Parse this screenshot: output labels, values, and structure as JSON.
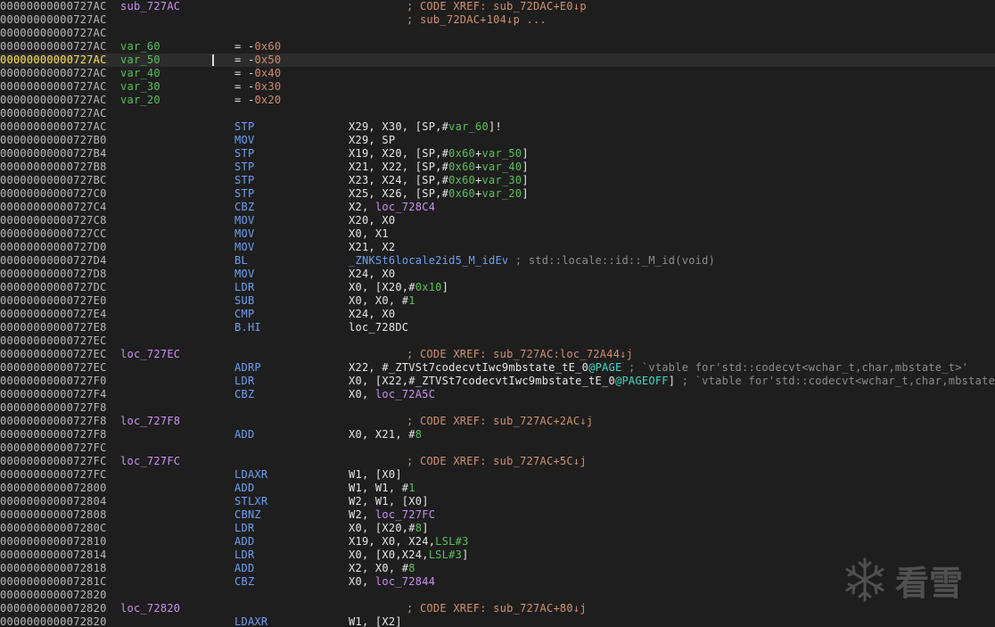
{
  "colors": {
    "background": "#1e1e1e",
    "current_line": "#2c2c2c",
    "address": "#b8b8b8",
    "current_address": "#ffe24a",
    "mnemonic": "#6d9ff5",
    "operand": "#e6e6e6",
    "label": "#c98ff0",
    "variable": "#58c058",
    "comment": "#8c8c8c",
    "xref": "#d0906e",
    "page_ref": "#3fd9c4"
  },
  "watermark": {
    "icon": "snowflake-icon",
    "text": "看雪"
  },
  "lines": [
    {
      "addr": "00000000000727AC",
      "label": "sub_727AC",
      "comment": "; CODE XREF: sub_72DAC+E0↓p"
    },
    {
      "addr": "00000000000727AC",
      "comment": "; sub_72DAC+104↓p ..."
    },
    {
      "addr": "00000000000727AC"
    },
    {
      "addr": "00000000000727AC",
      "var": "var_60",
      "eq": "= -0x60"
    },
    {
      "addr": "00000000000727AC",
      "var": "var_50",
      "eq": "= -0x50",
      "current": true
    },
    {
      "addr": "00000000000727AC",
      "var": "var_40",
      "eq": "= -0x40"
    },
    {
      "addr": "00000000000727AC",
      "var": "var_30",
      "eq": "= -0x30"
    },
    {
      "addr": "00000000000727AC",
      "var": "var_20",
      "eq": "= -0x20"
    },
    {
      "addr": "00000000000727AC"
    },
    {
      "addr": "00000000000727AC",
      "mnem": "STP",
      "ops": [
        [
          "X29, X30, [SP,#",
          ""
        ],
        [
          "var_60",
          "var"
        ],
        [
          "]!",
          ""
        ]
      ]
    },
    {
      "addr": "00000000000727B0",
      "mnem": "MOV",
      "ops": [
        [
          "X29, SP",
          ""
        ]
      ]
    },
    {
      "addr": "00000000000727B4",
      "mnem": "STP",
      "ops": [
        [
          "X19, X20, [SP,#",
          ""
        ],
        [
          "0x60",
          "num"
        ],
        [
          "+",
          ""
        ],
        [
          "var_50",
          "var"
        ],
        [
          "]",
          ""
        ]
      ]
    },
    {
      "addr": "00000000000727B8",
      "mnem": "STP",
      "ops": [
        [
          "X21, X22, [SP,#",
          ""
        ],
        [
          "0x60",
          "num"
        ],
        [
          "+",
          ""
        ],
        [
          "var_40",
          "var"
        ],
        [
          "]",
          ""
        ]
      ]
    },
    {
      "addr": "00000000000727BC",
      "mnem": "STP",
      "ops": [
        [
          "X23, X24, [SP,#",
          ""
        ],
        [
          "0x60",
          "num"
        ],
        [
          "+",
          ""
        ],
        [
          "var_30",
          "var"
        ],
        [
          "]",
          ""
        ]
      ]
    },
    {
      "addr": "00000000000727C0",
      "mnem": "STP",
      "ops": [
        [
          "X25, X26, [SP,#",
          ""
        ],
        [
          "0x60",
          "num"
        ],
        [
          "+",
          ""
        ],
        [
          "var_20",
          "var"
        ],
        [
          "]",
          ""
        ]
      ]
    },
    {
      "addr": "00000000000727C4",
      "mnem": "CBZ",
      "ops": [
        [
          "X2, ",
          ""
        ],
        [
          "loc_728C4",
          "loc"
        ]
      ]
    },
    {
      "addr": "00000000000727C8",
      "mnem": "MOV",
      "ops": [
        [
          "X20, X0",
          ""
        ]
      ]
    },
    {
      "addr": "00000000000727CC",
      "mnem": "MOV",
      "ops": [
        [
          "X0, X1",
          ""
        ]
      ]
    },
    {
      "addr": "00000000000727D0",
      "mnem": "MOV",
      "ops": [
        [
          "X21, X2",
          ""
        ]
      ]
    },
    {
      "addr": "00000000000727D4",
      "mnem": "BL",
      "ops": [
        [
          "_ZNKSt6locale2id5_M_idEv",
          "sym"
        ],
        [
          " ; std::locale::id::_M_id(void)",
          "ccom"
        ]
      ]
    },
    {
      "addr": "00000000000727D8",
      "mnem": "MOV",
      "ops": [
        [
          "X24, X0",
          ""
        ]
      ]
    },
    {
      "addr": "00000000000727DC",
      "mnem": "LDR",
      "ops": [
        [
          "X0, [X20,#",
          ""
        ],
        [
          "0x10",
          "num"
        ],
        [
          "]",
          ""
        ]
      ]
    },
    {
      "addr": "00000000000727E0",
      "mnem": "SUB",
      "ops": [
        [
          "X0, X0, #",
          ""
        ],
        [
          "1",
          "num"
        ]
      ]
    },
    {
      "addr": "00000000000727E4",
      "mnem": "CMP",
      "ops": [
        [
          "X24, X0",
          ""
        ]
      ]
    },
    {
      "addr": "00000000000727E8",
      "mnem": "B.HI",
      "ops": [
        [
          "loc_728DC",
          ""
        ]
      ]
    },
    {
      "addr": "00000000000727EC"
    },
    {
      "addr": "00000000000727EC",
      "label": "loc_727EC",
      "comment": "; CODE XREF: sub_727AC:loc_72A44↓j"
    },
    {
      "addr": "00000000000727EC",
      "mnem": "ADRP",
      "ops": [
        [
          "X22, #_ZTVSt7codecvtIwc9mbstate_tE_0",
          ""
        ],
        [
          "@PAGE",
          "pg"
        ],
        [
          " ; `vtable for'std::codecvt<wchar_t,char,mbstate_t>'",
          "ccom"
        ]
      ]
    },
    {
      "addr": "00000000000727F0",
      "mnem": "LDR",
      "ops": [
        [
          "X0, [X22,#_ZTVSt7codecvtIwc9mbstate_tE_0",
          ""
        ],
        [
          "@PAGEOFF",
          "pg"
        ],
        [
          "]",
          ""
        ],
        [
          " ; `vtable for'std::codecvt<wchar_t,char,mbstate_t>'",
          "ccom"
        ]
      ]
    },
    {
      "addr": "00000000000727F4",
      "mnem": "CBZ",
      "ops": [
        [
          "X0, ",
          ""
        ],
        [
          "loc_72A5C",
          "loc"
        ]
      ]
    },
    {
      "addr": "00000000000727F8"
    },
    {
      "addr": "00000000000727F8",
      "label": "loc_727F8",
      "comment": "; CODE XREF: sub_727AC+2AC↓j"
    },
    {
      "addr": "00000000000727F8",
      "mnem": "ADD",
      "ops": [
        [
          "X0, X21, #",
          ""
        ],
        [
          "8",
          "num"
        ]
      ]
    },
    {
      "addr": "00000000000727FC"
    },
    {
      "addr": "00000000000727FC",
      "label": "loc_727FC",
      "comment": "; CODE XREF: sub_727AC+5C↓j"
    },
    {
      "addr": "00000000000727FC",
      "mnem": "LDAXR",
      "ops": [
        [
          "W1, [X0]",
          ""
        ]
      ]
    },
    {
      "addr": "0000000000072800",
      "mnem": "ADD",
      "ops": [
        [
          "W1, W1, #",
          ""
        ],
        [
          "1",
          "num"
        ]
      ]
    },
    {
      "addr": "0000000000072804",
      "mnem": "STLXR",
      "ops": [
        [
          "W2, W1, [X0]",
          ""
        ]
      ]
    },
    {
      "addr": "0000000000072808",
      "mnem": "CBNZ",
      "ops": [
        [
          "W2, ",
          ""
        ],
        [
          "loc_727FC",
          "loc"
        ]
      ]
    },
    {
      "addr": "000000000007280C",
      "mnem": "LDR",
      "ops": [
        [
          "X0, [X20,#",
          ""
        ],
        [
          "8",
          "num"
        ],
        [
          "]",
          ""
        ]
      ]
    },
    {
      "addr": "0000000000072810",
      "mnem": "ADD",
      "ops": [
        [
          "X19, X0, X24,",
          ""
        ],
        [
          "LSL#3",
          "num"
        ]
      ]
    },
    {
      "addr": "0000000000072814",
      "mnem": "LDR",
      "ops": [
        [
          "X0, [X0,X24,",
          ""
        ],
        [
          "LSL#3",
          "num"
        ],
        [
          "]",
          ""
        ]
      ]
    },
    {
      "addr": "0000000000072818",
      "mnem": "ADD",
      "ops": [
        [
          "X2, X0, #",
          ""
        ],
        [
          "8",
          "num"
        ]
      ]
    },
    {
      "addr": "000000000007281C",
      "mnem": "CBZ",
      "ops": [
        [
          "X0, ",
          ""
        ],
        [
          "loc_72844",
          "loc"
        ]
      ]
    },
    {
      "addr": "0000000000072820"
    },
    {
      "addr": "0000000000072820",
      "label": "loc_72820",
      "comment": "; CODE XREF: sub_727AC+80↓j"
    },
    {
      "addr": "0000000000072820",
      "mnem": "LDAXR",
      "ops": [
        [
          "W1, [X2]",
          ""
        ]
      ]
    }
  ]
}
